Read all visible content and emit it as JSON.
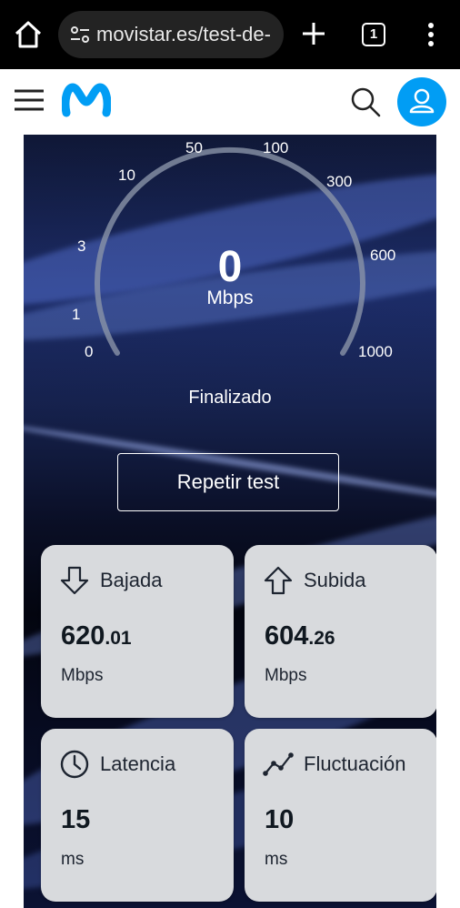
{
  "browser": {
    "url": "movistar.es/test-de-",
    "tab_count": "1"
  },
  "gauge": {
    "ticks": [
      "50",
      "100",
      "10",
      "300",
      "3",
      "600",
      "1",
      "0",
      "1000"
    ],
    "speed": "0",
    "unit": "Mbps",
    "status": "Finalizado"
  },
  "actions": {
    "repeat_label": "Repetir test"
  },
  "stats": {
    "download": {
      "label": "Bajada",
      "value_int": "620",
      "value_dec": ".01",
      "unit": "Mbps"
    },
    "upload": {
      "label": "Subida",
      "value_int": "604",
      "value_dec": ".26",
      "unit": "Mbps"
    },
    "latency": {
      "label": "Latencia",
      "value": "15",
      "unit": "ms"
    },
    "jitter": {
      "label": "Fluctuación",
      "value": "10",
      "unit": "ms"
    }
  },
  "colors": {
    "brand_blue": "#019df4",
    "card_bg": "#d8dadd"
  }
}
